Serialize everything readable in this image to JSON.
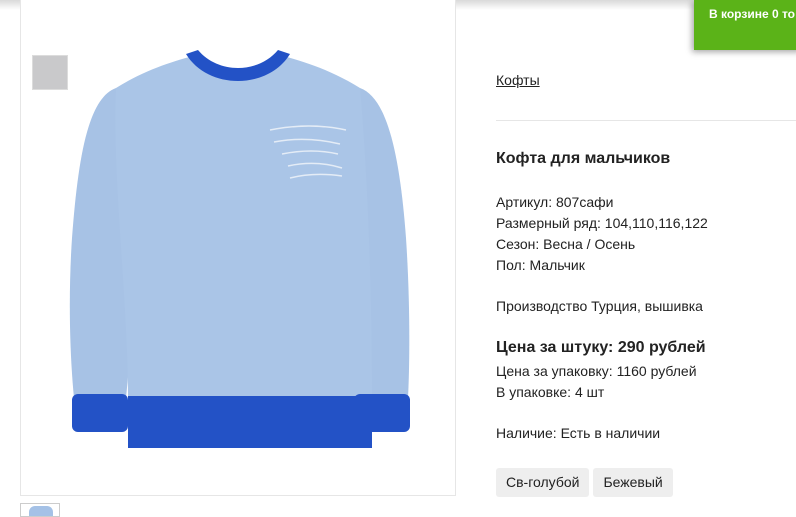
{
  "cart": {
    "text": "В корзине 0 то"
  },
  "breadcrumb": {
    "label": "Кофты"
  },
  "product": {
    "title": "Кофта для мальчиков",
    "article": "Артикул: 807сафи",
    "sizes": "Размерный ряд: 104,110,116,122",
    "season": "Сезон: Весна / Осень",
    "gender": "Пол: Мальчик",
    "production": "Производство Турция, вышивка",
    "price_unit": "Цена за штуку: 290 рублей",
    "price_pack": "Цена за упаковку: 1160 рублей",
    "pack_qty": "В упаковке: 4 шт",
    "availability": "Наличие: Есть в наличии"
  },
  "colors": [
    "Св-голубой",
    "Бежевый"
  ],
  "theme": {
    "accent_green": "#5bb318",
    "garment_blue": "#a4c1e6",
    "trim_blue": "#2150c8"
  },
  "icons": {
    "thumbnail_grey": "grey-swatch-thumbnail",
    "thumbnail_bottom": "sweater-thumbnail"
  }
}
